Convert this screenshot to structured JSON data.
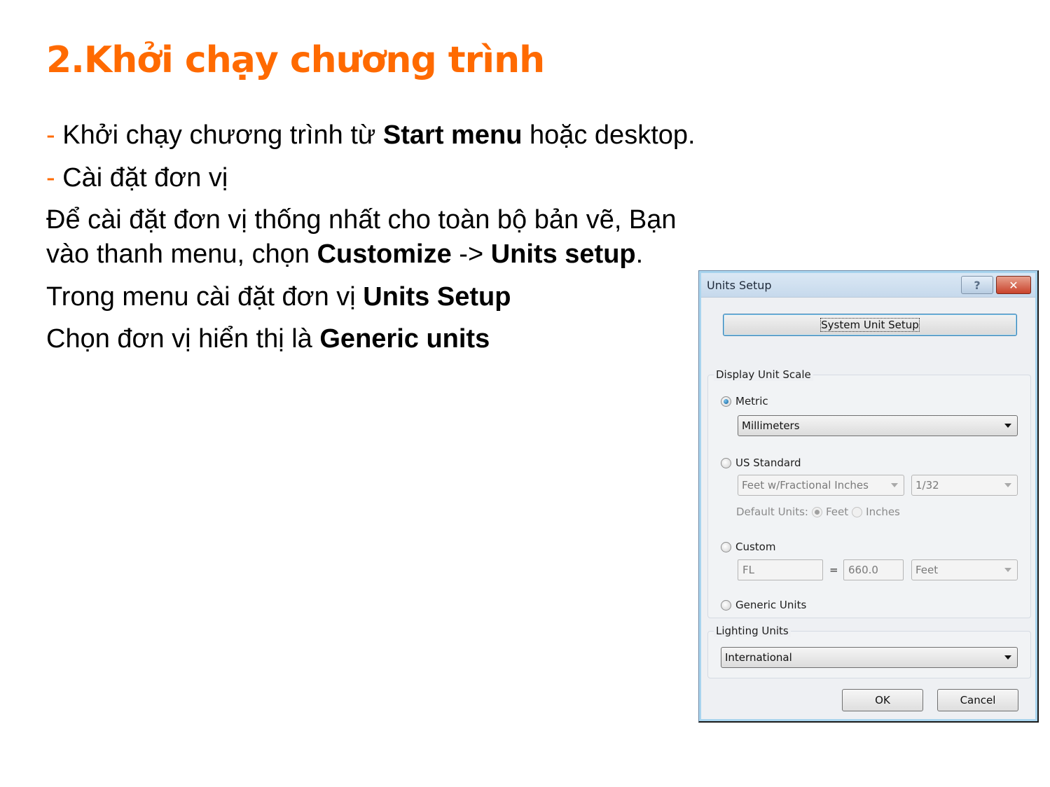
{
  "slide": {
    "title": "2.Khởi chạy chương trình",
    "bullets": [
      {
        "dash": "-",
        "pre": "Khởi chạy chương trình từ ",
        "bold": "Start menu",
        "post": " hoặc desktop."
      },
      {
        "dash": "-",
        "pre": " Cài đặt đơn vị"
      }
    ],
    "para1_line1": "Để cài đặt đơn vị thống nhất cho toàn bộ bản vẽ, Bạn",
    "para1_line2_pre": "vào thanh menu, chọn ",
    "para1_line2_bold1": "Customize",
    "para1_line2_mid": " -> ",
    "para1_line2_bold2": "Units setup",
    "para1_line2_post": ".",
    "para2_pre": "Trong menu cài đặt đơn vị ",
    "para2_bold": "Units Setup",
    "para3_pre": "Chọn đơn vị hiển thị là ",
    "para3_bold": "Generic units"
  },
  "dialog": {
    "title": "Units Setup",
    "help_icon": "?",
    "close_icon": "✕",
    "system_unit_setup_label": "System Unit Setup",
    "display_unit_scale": {
      "label": "Display Unit Scale",
      "metric": {
        "label": "Metric",
        "checked": true,
        "selected": "Millimeters"
      },
      "us_standard": {
        "label": "US Standard",
        "checked": false,
        "unit_selected": "Feet w/Fractional Inches",
        "fraction_selected": "1/32",
        "default_units_label": "Default Units:",
        "feet_label": "Feet",
        "feet_checked": true,
        "inches_label": "Inches",
        "inches_checked": false
      },
      "custom": {
        "label": "Custom",
        "checked": false,
        "name_value": "FL",
        "equals": "=",
        "amount_value": "660.0",
        "unit_selected": "Feet"
      },
      "generic": {
        "label": "Generic Units",
        "checked": false
      }
    },
    "lighting_units": {
      "label": "Lighting Units",
      "selected": "International"
    },
    "ok_label": "OK",
    "cancel_label": "Cancel"
  }
}
